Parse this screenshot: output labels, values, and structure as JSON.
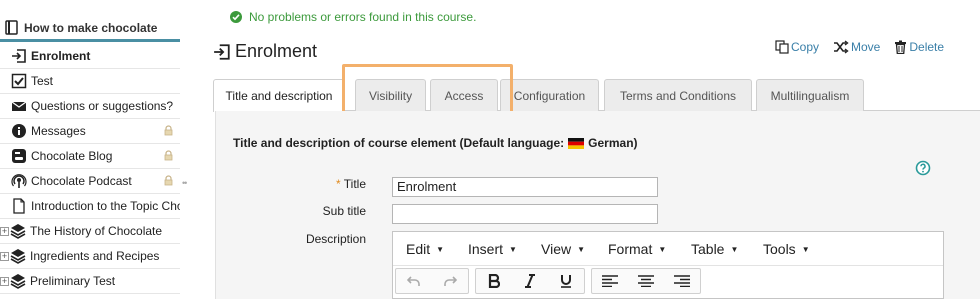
{
  "sidebar": {
    "course_title": "How to make chocolate",
    "items": [
      {
        "label": "Enrolment",
        "icon": "enrolment-icon"
      },
      {
        "label": "Test",
        "icon": "checkbox-icon"
      },
      {
        "label": "Questions or suggestions?",
        "icon": "envelope-icon"
      },
      {
        "label": "Messages",
        "icon": "info-icon"
      },
      {
        "label": "Chocolate Blog",
        "icon": "blog-icon"
      },
      {
        "label": "Chocolate Podcast",
        "icon": "podcast-icon"
      },
      {
        "label": "Introduction to the Topic Chocolate",
        "icon": "document-icon"
      },
      {
        "label": "The History of Chocolate",
        "icon": "stack-icon"
      },
      {
        "label": "Ingredients and Recipes",
        "icon": "stack-icon"
      },
      {
        "label": "Preliminary Test",
        "icon": "stack-icon"
      }
    ]
  },
  "status": {
    "message": "No problems or errors found in this course."
  },
  "page": {
    "title": "Enrolment"
  },
  "actions": {
    "copy": "Copy",
    "move": "Move",
    "delete": "Delete"
  },
  "tabs": [
    {
      "label": "Title and description"
    },
    {
      "label": "Visibility"
    },
    {
      "label": "Access"
    },
    {
      "label": "Configuration"
    },
    {
      "label": "Terms and Conditions"
    },
    {
      "label": "Multilingualism"
    }
  ],
  "form": {
    "heading": "Title and description of course element (Default language:",
    "language": "German",
    "heading_close": ")",
    "title_label": "Title",
    "required_mark": "*",
    "title_value": "Enrolment",
    "subtitle_label": "Sub title",
    "subtitle_value": "",
    "description_label": "Description"
  },
  "editor": {
    "menus": [
      "Edit",
      "Insert",
      "View",
      "Format",
      "Table",
      "Tools"
    ]
  },
  "colors": {
    "accent": "#3a7fa8",
    "success": "#3c9a3c",
    "highlight": "#f3b06b",
    "required": "#e08a1e"
  }
}
